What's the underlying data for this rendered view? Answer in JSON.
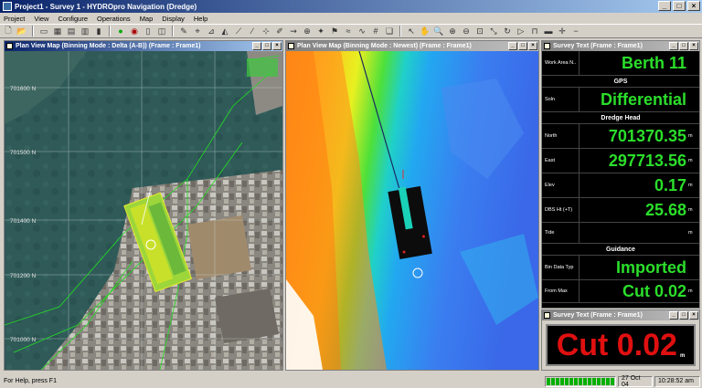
{
  "window": {
    "title": "Project1 - Survey 1 - HYDROpro Navigation (Dredge)",
    "min": "_",
    "max": "□",
    "close": "×"
  },
  "menu": [
    "Project",
    "View",
    "Configure",
    "Operations",
    "Map",
    "Display",
    "Help"
  ],
  "pane_buttons": {
    "min": "_",
    "max": "□",
    "close": "×"
  },
  "pane_left": {
    "title": "Plan View Map (Binning Mode : Delta (A-B))  (Frame : Frame1)",
    "grid_labels": [
      "701600 N",
      "701500 N",
      "701400 N",
      "701200 N",
      "701000 N"
    ]
  },
  "pane_mid": {
    "title": "Plan View Map (Binning Mode : Newest)  (Frame : Frame1)"
  },
  "survey_text": {
    "title": "Survey Text  (Frame : Frame1)",
    "rows": [
      {
        "type": "row",
        "label": "Work Area N..",
        "value": "Berth 11",
        "unit": ""
      },
      {
        "type": "head",
        "label": "GPS"
      },
      {
        "type": "row",
        "label": "Soln",
        "value": "Differential",
        "unit": ""
      },
      {
        "type": "head",
        "label": "Dredge Head"
      },
      {
        "type": "row",
        "label": "North",
        "value": "701370.35",
        "unit": "m"
      },
      {
        "type": "row",
        "label": "East",
        "value": "297713.56",
        "unit": "m"
      },
      {
        "type": "row",
        "label": "Elev",
        "value": "0.17",
        "unit": "m"
      },
      {
        "type": "row",
        "label": "DBS Ht (+T)",
        "value": "25.68",
        "unit": "m"
      },
      {
        "type": "row",
        "label": "Tide",
        "value": "",
        "unit": "m"
      },
      {
        "type": "head",
        "label": "Guidance"
      },
      {
        "type": "row",
        "label": "Bin Data Typ",
        "value": "Imported",
        "unit": ""
      },
      {
        "type": "row",
        "label": "From Max",
        "value": "Cut 0.02",
        "unit": "m"
      }
    ]
  },
  "survey_text2": {
    "title": "Survey Text  (Frame : Frame1)",
    "big_value": "Cut 0.02",
    "big_unit": "m"
  },
  "status": {
    "help": "For Help, press F1",
    "date": "27 Oct 04",
    "time": "10:28:52 am"
  },
  "colors": {
    "value_green": "#2bde2b",
    "cut_red": "#e01010"
  }
}
